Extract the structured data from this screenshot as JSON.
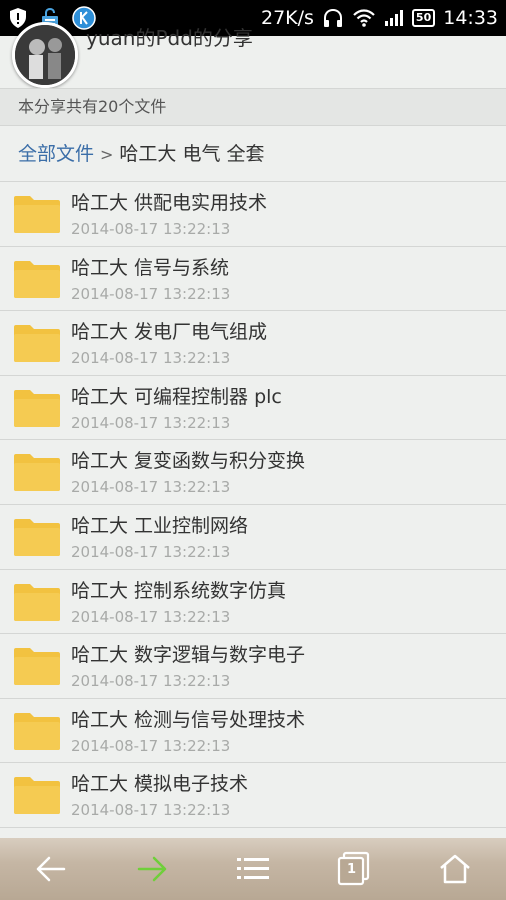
{
  "statusbar": {
    "speed": "27K/s",
    "battery": "50",
    "time": "14:33"
  },
  "header": {
    "username": "yuan的Pdd的分享"
  },
  "share_count": "本分享共有20个文件",
  "breadcrumb": {
    "root": "全部文件",
    "separator": ">",
    "current": "哈工大 电气 全套"
  },
  "files": [
    {
      "name": "哈工大 供配电实用技术",
      "date": "2014-08-17 13:22:13"
    },
    {
      "name": "哈工大 信号与系统",
      "date": "2014-08-17 13:22:13"
    },
    {
      "name": "哈工大 发电厂电气组成",
      "date": "2014-08-17 13:22:13"
    },
    {
      "name": "哈工大 可编程控制器 plc",
      "date": "2014-08-17 13:22:13"
    },
    {
      "name": "哈工大 复变函数与积分变换",
      "date": "2014-08-17 13:22:13"
    },
    {
      "name": "哈工大 工业控制网络",
      "date": "2014-08-17 13:22:13"
    },
    {
      "name": "哈工大 控制系统数字仿真",
      "date": "2014-08-17 13:22:13"
    },
    {
      "name": "哈工大 数字逻辑与数字电子",
      "date": "2014-08-17 13:22:13"
    },
    {
      "name": "哈工大 检测与信号处理技术",
      "date": "2014-08-17 13:22:13"
    },
    {
      "name": "哈工大 模拟电子技术",
      "date": "2014-08-17 13:22:13"
    }
  ],
  "colors": {
    "folder": "#f2c240",
    "link": "#3b6ea8",
    "forward_arrow": "#6fcf3a"
  },
  "tab_count": "1"
}
